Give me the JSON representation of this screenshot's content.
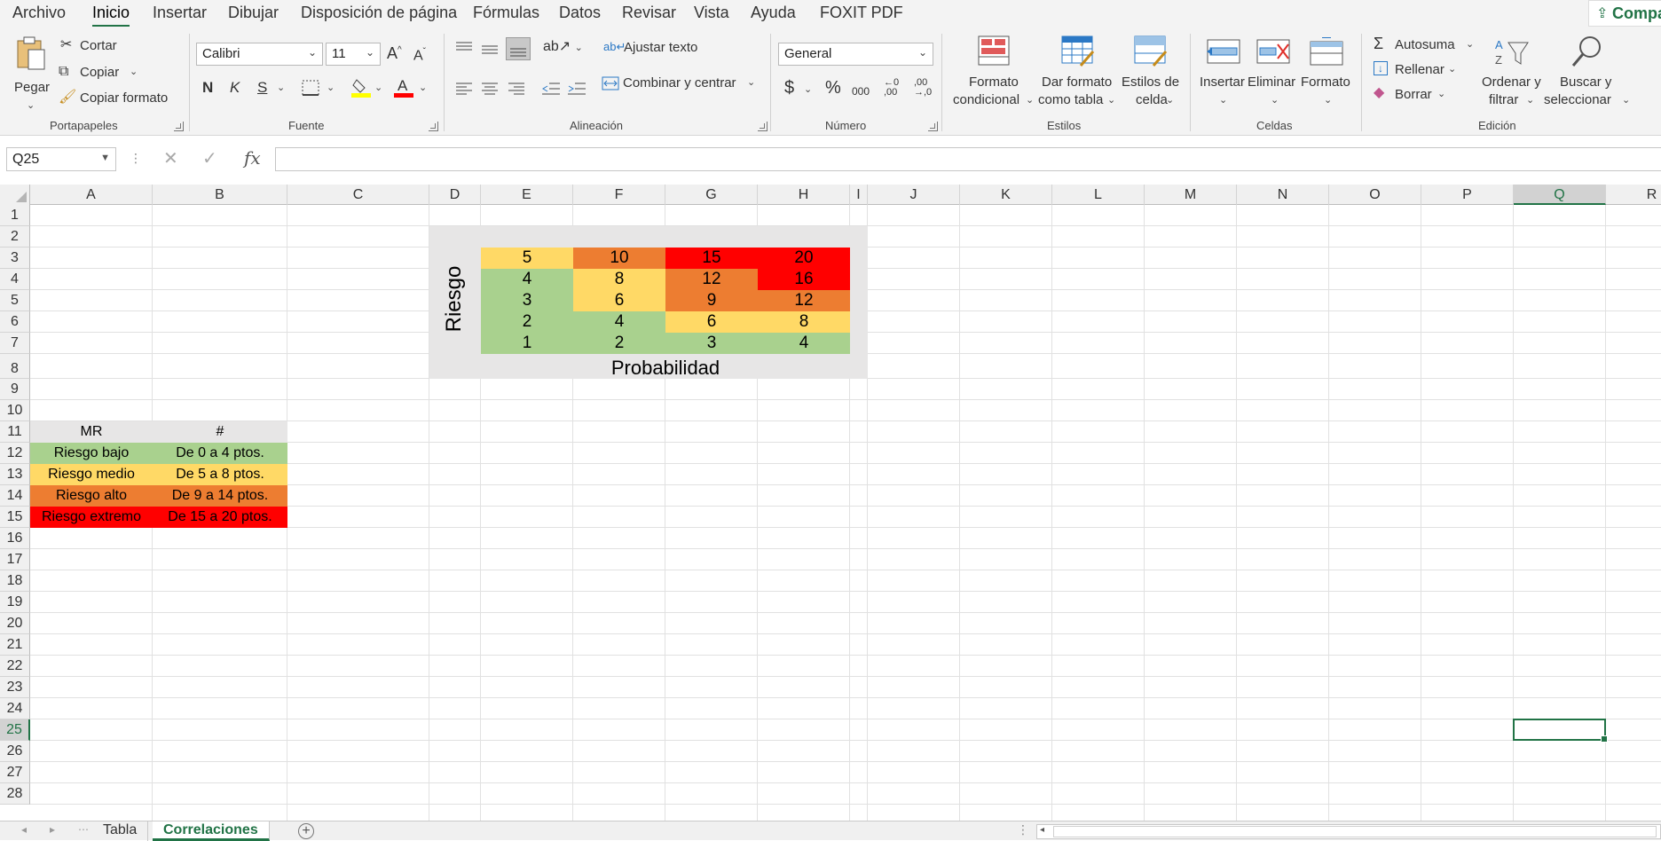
{
  "menu": {
    "tabs": [
      "Archivo",
      "Inicio",
      "Insertar",
      "Dibujar",
      "Disposición de página",
      "Fórmulas",
      "Datos",
      "Revisar",
      "Vista",
      "Ayuda",
      "FOXIT PDF"
    ],
    "share": "Compa"
  },
  "ribbon": {
    "portapapeles": {
      "paste": "Pegar",
      "cut": "Cortar",
      "copy": "Copiar",
      "format_painter": "Copiar formato",
      "label": "Portapapeles"
    },
    "fuente": {
      "font_name": "Calibri",
      "font_size": "11",
      "bold": "N",
      "italic": "K",
      "underline": "S",
      "label": "Fuente"
    },
    "alineacion": {
      "wrap_text": "Ajustar texto",
      "merge_center": "Combinar y centrar",
      "label": "Alineación"
    },
    "numero": {
      "format": "General",
      "currency": "$",
      "percent": "%",
      "thousands": "000",
      "label": "Número"
    },
    "estilos": {
      "conditional_1": "Formato",
      "conditional_2": "condicional",
      "table_1": "Dar formato",
      "table_2": "como tabla",
      "cell_1": "Estilos de",
      "cell_2": "celda",
      "label": "Estilos"
    },
    "celdas": {
      "insert": "Insertar",
      "delete": "Eliminar",
      "format": "Formato",
      "label": "Celdas"
    },
    "edicion": {
      "autosum": "Autosuma",
      "fill": "Rellenar",
      "clear": "Borrar",
      "sort_1": "Ordenar y",
      "sort_2": "filtrar",
      "find_1": "Buscar y",
      "find_2": "seleccionar",
      "label": "Edición"
    }
  },
  "formula_bar": {
    "name_box": "Q25",
    "fx": "fx",
    "content": ""
  },
  "columns": [
    "A",
    "B",
    "C",
    "D",
    "E",
    "F",
    "G",
    "H",
    "I",
    "J",
    "K",
    "L",
    "M",
    "N",
    "O",
    "P",
    "Q",
    "R"
  ],
  "rows": [
    "1",
    "2",
    "3",
    "4",
    "5",
    "6",
    "7",
    "8",
    "9",
    "10",
    "11",
    "12",
    "13",
    "14",
    "15",
    "16",
    "17",
    "18",
    "19",
    "20",
    "21",
    "22",
    "23",
    "24",
    "25",
    "26",
    "27",
    "28"
  ],
  "selected_cell": "Q25",
  "matrix": {
    "y_label": "Riesgo",
    "x_label": "Probabilidad",
    "rows": [
      [
        "5",
        "10",
        "15",
        "20"
      ],
      [
        "4",
        "8",
        "12",
        "16"
      ],
      [
        "3",
        "6",
        "9",
        "12"
      ],
      [
        "2",
        "4",
        "6",
        "8"
      ],
      [
        "1",
        "2",
        "3",
        "4"
      ]
    ],
    "levels": [
      [
        "medio",
        "alto",
        "extremo",
        "extremo"
      ],
      [
        "bajo",
        "medio",
        "alto",
        "extremo"
      ],
      [
        "bajo",
        "medio",
        "alto",
        "alto"
      ],
      [
        "bajo",
        "bajo",
        "medio",
        "medio"
      ],
      [
        "bajo",
        "bajo",
        "bajo",
        "bajo"
      ]
    ]
  },
  "legend": {
    "header": [
      "MR",
      "#"
    ],
    "rows": [
      {
        "level": "bajo",
        "label": "Riesgo bajo",
        "range": "De 0 a 4 ptos."
      },
      {
        "level": "medio",
        "label": "Riesgo medio",
        "range": "De 5 a 8 ptos."
      },
      {
        "level": "alto",
        "label": "Riesgo alto",
        "range": "De 9 a 14 ptos."
      },
      {
        "level": "extremo",
        "label": "Riesgo extremo",
        "range": "De 15 a 20 ptos."
      }
    ]
  },
  "colors": {
    "bajo": "#a9d18e",
    "medio": "#ffd966",
    "alto": "#ed7d31",
    "extremo": "#ff0000",
    "panel": "#e7e6e6",
    "accent": "#217346"
  },
  "sheets": {
    "tabs": [
      "Tabla",
      "Correlaciones"
    ],
    "active": "Correlaciones"
  }
}
